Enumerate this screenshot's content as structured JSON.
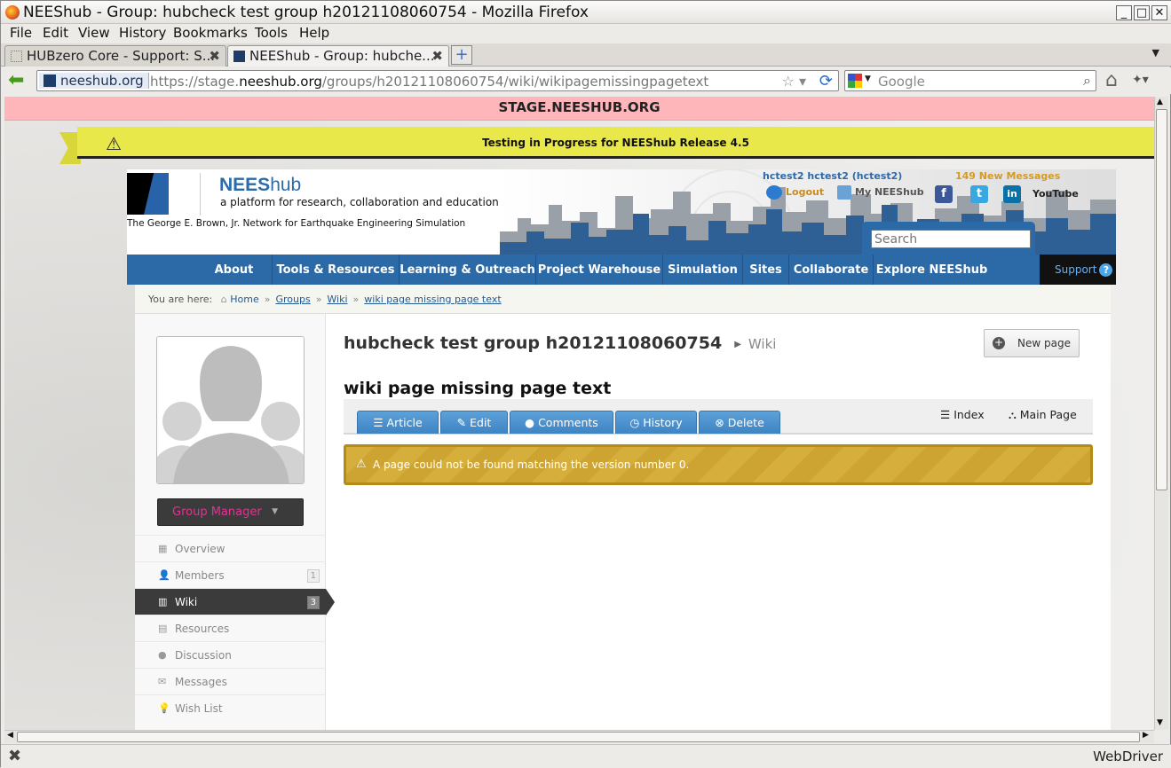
{
  "window": {
    "title": "NEEShub - Group: hubcheck test group h20121108060754 - Mozilla Firefox",
    "buttons": {
      "minimize": "_",
      "maximize": "□",
      "close": "✕"
    }
  },
  "menu": [
    "File",
    "Edit",
    "View",
    "History",
    "Bookmarks",
    "Tools",
    "Help"
  ],
  "tabs": [
    {
      "label": "HUBzero Core - Support: S...",
      "active": false
    },
    {
      "label": "NEEShub - Group: hubche...",
      "active": true
    }
  ],
  "urlbar": {
    "identity": "neeshub.org",
    "url_prefix": "https://stage.",
    "url_domain": "neeshub.org",
    "url_path": "/groups/h20121108060754/wiki/wikipagemissingpagetext"
  },
  "browser_search": {
    "placeholder": "Google"
  },
  "statusbar": {
    "right": "WebDriver"
  },
  "page": {
    "stage_banner": "STAGE.NEESHUB.ORG",
    "notice": "Testing in Progress for NEEShub Release 4.5",
    "header": {
      "logo_name": "NEES",
      "logo_name_suffix": "hub",
      "tagline": "a platform for research, collaboration and education",
      "subtitle": "The George E. Brown, Jr. Network for Earthquake Engineering Simulation",
      "user": "hctest2 hctest2 (hctest2)",
      "messages": "149 New Messages",
      "logout": "Logout",
      "my_hub": "My NEEShub",
      "search_placeholder": "Search",
      "social": [
        "f",
        "t",
        "in",
        "YouTube"
      ]
    },
    "nav": [
      "About NEES",
      "Tools & Resources",
      "Learning & Outreach",
      "Project Warehouse",
      "Simulation",
      "Sites",
      "Collaborate",
      "Explore NEEShub"
    ],
    "support": "Support",
    "breadcrumb": {
      "prefix": "You are here:",
      "items": [
        "Home",
        "Groups",
        "Wiki",
        "wiki page missing page text"
      ]
    },
    "sidebar": {
      "group_manager": "Group Manager",
      "items": [
        {
          "label": "Overview",
          "count": ""
        },
        {
          "label": "Members",
          "count": "1"
        },
        {
          "label": "Wiki",
          "count": "3",
          "active": true
        },
        {
          "label": "Resources",
          "count": ""
        },
        {
          "label": "Discussion",
          "count": ""
        },
        {
          "label": "Messages",
          "count": ""
        },
        {
          "label": "Wish List",
          "count": ""
        }
      ]
    },
    "group_title": "hubcheck test group h20121108060754",
    "section": "Wiki",
    "new_page": "New page",
    "page_title": "wiki page missing page text",
    "wiki_tabs": [
      "Article",
      "Edit",
      "Comments",
      "History",
      "Delete"
    ],
    "wiki_links": [
      "Index",
      "Main Page"
    ],
    "warning": "A page could not be found matching the version number 0."
  }
}
